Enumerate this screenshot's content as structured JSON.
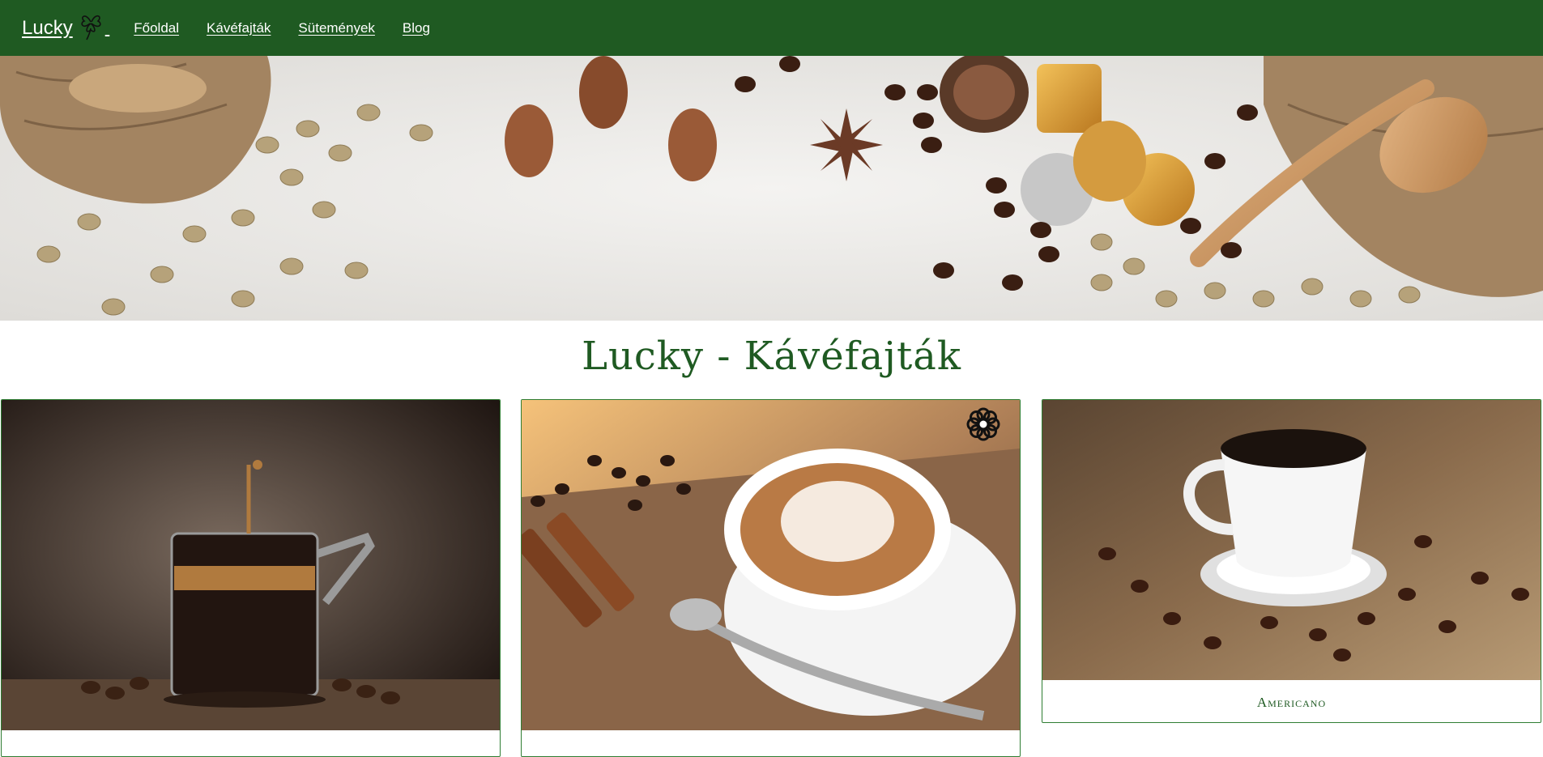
{
  "navbar": {
    "brand": "Lucky",
    "links": [
      "Főoldal",
      "Kávéfajták",
      "Sütemények",
      "Blog"
    ]
  },
  "page": {
    "title": "Lucky - Kávéfajták"
  },
  "cards": [
    {
      "caption": ""
    },
    {
      "caption": ""
    },
    {
      "caption": "Americano"
    }
  ],
  "colors": {
    "primary": "#1f5a22",
    "card_border": "#2e7d32"
  }
}
